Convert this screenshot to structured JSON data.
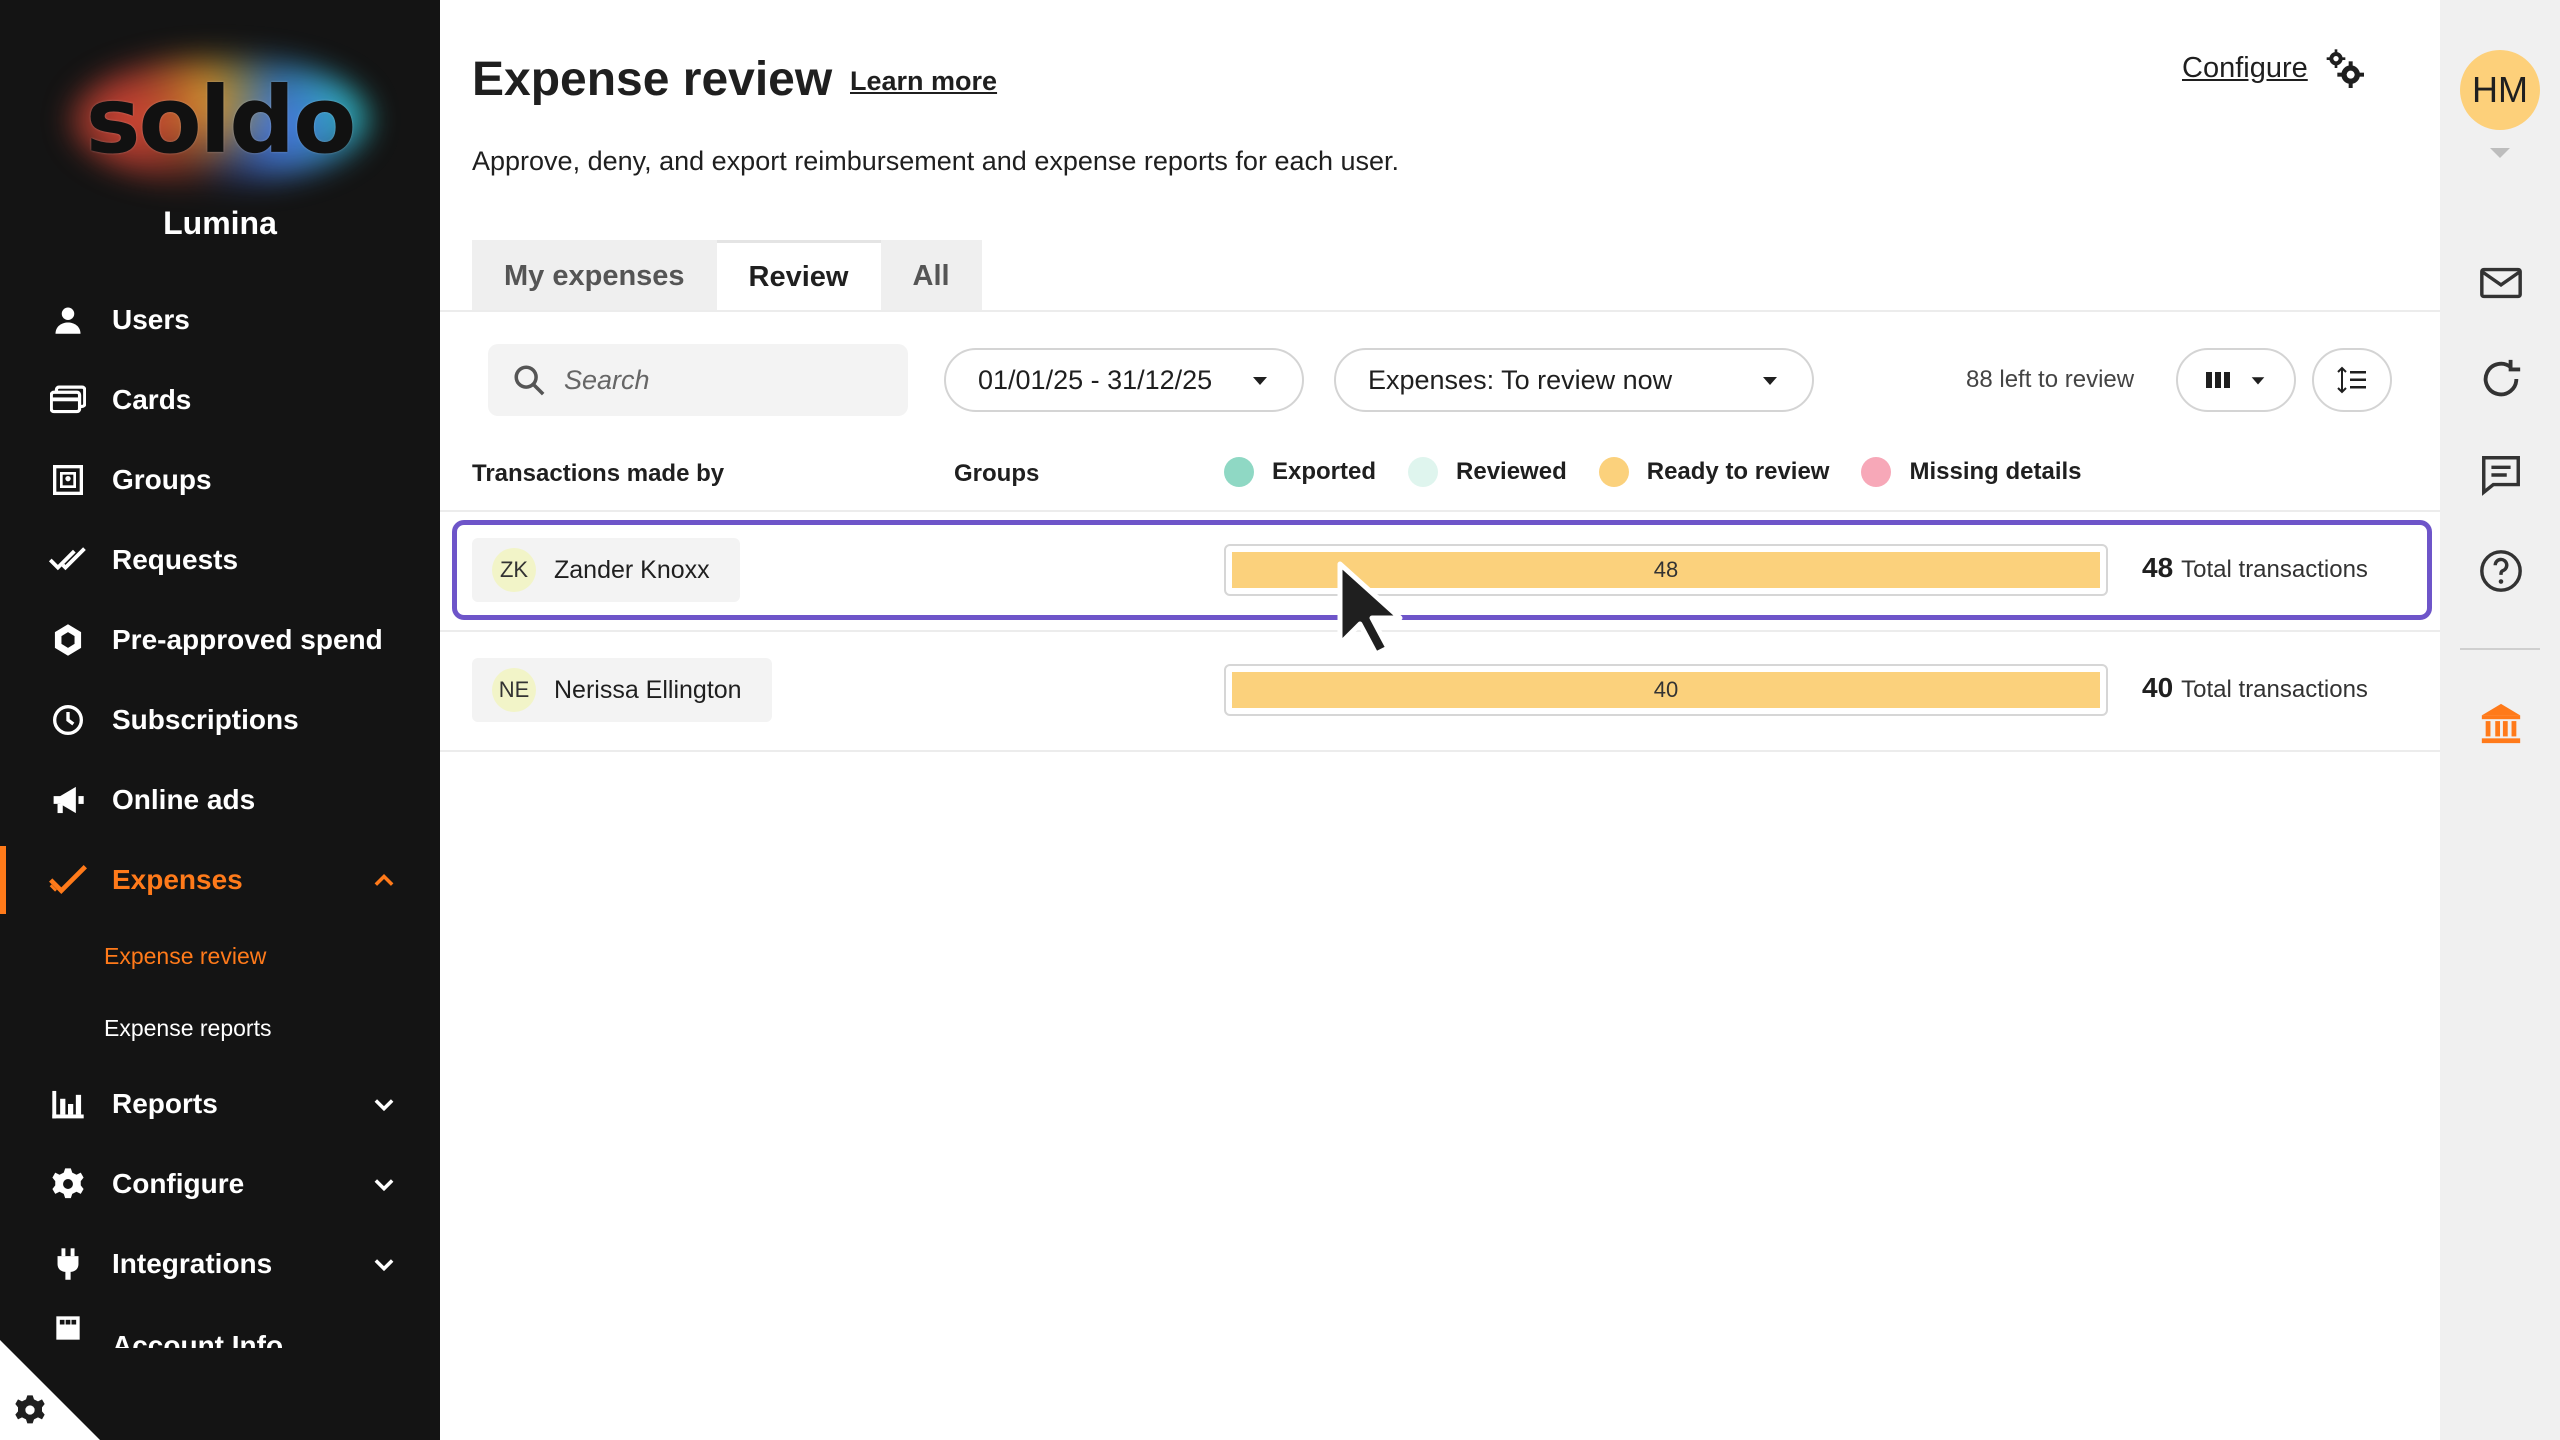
{
  "sidebar": {
    "logo_text": "soldo",
    "org_name": "Lumina",
    "items": [
      {
        "label": "Users"
      },
      {
        "label": "Cards"
      },
      {
        "label": "Groups"
      },
      {
        "label": "Requests"
      },
      {
        "label": "Pre-approved spend"
      },
      {
        "label": "Subscriptions"
      },
      {
        "label": "Online ads"
      },
      {
        "label": "Expenses"
      },
      {
        "label": "Reports"
      },
      {
        "label": "Configure"
      },
      {
        "label": "Integrations"
      },
      {
        "label": "Account Info"
      }
    ],
    "subitems": [
      {
        "label": "Expense review"
      },
      {
        "label": "Expense reports"
      }
    ]
  },
  "header": {
    "title": "Expense review",
    "learn_more": "Learn more",
    "configure": "Configure",
    "subtitle": "Approve, deny, and export reimbursement and expense reports for each user."
  },
  "tabs": [
    {
      "label": "My expenses"
    },
    {
      "label": "Review"
    },
    {
      "label": "All"
    }
  ],
  "filters": {
    "search_placeholder": "Search",
    "date_range": "01/01/25 - 31/12/25",
    "status": "Expenses: To review now",
    "left_count": "88 left to review"
  },
  "table": {
    "col_user": "Transactions made by",
    "col_groups": "Groups",
    "legend": [
      {
        "label": "Exported",
        "color": "#8fd8c4"
      },
      {
        "label": "Reviewed",
        "color": "#dff5ee"
      },
      {
        "label": "Ready to review",
        "color": "#fbd17c"
      },
      {
        "label": "Missing details",
        "color": "#f7a8b8"
      }
    ],
    "rows": [
      {
        "initials": "ZK",
        "name": "Zander Knoxx",
        "bar_value": "48",
        "total": "48",
        "total_label": "Total transactions",
        "selected": true
      },
      {
        "initials": "NE",
        "name": "Nerissa Ellington",
        "bar_value": "40",
        "total": "40",
        "total_label": "Total transactions",
        "selected": false
      }
    ]
  },
  "user": {
    "initials": "HM"
  },
  "colors": {
    "accent": "#ff7a1a",
    "selection": "#6e55c9",
    "sidebar_bg": "#141414"
  }
}
